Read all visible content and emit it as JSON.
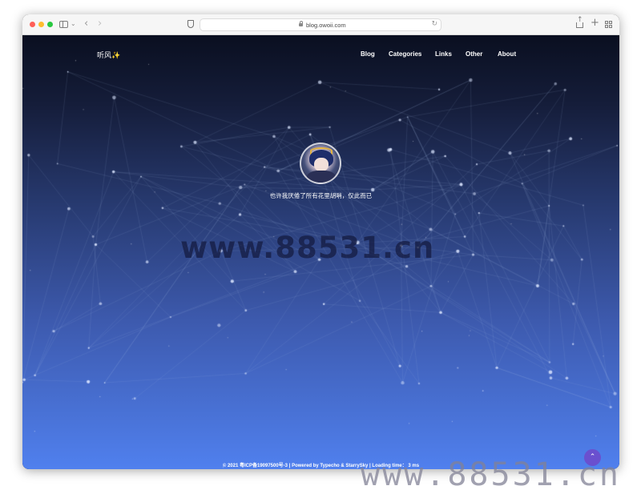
{
  "browser": {
    "url": "blog.owoii.com"
  },
  "site": {
    "brand": "听风✨",
    "nav": [
      {
        "label": "Blog"
      },
      {
        "label": "Categories"
      },
      {
        "label": "Links"
      },
      {
        "label": "Other"
      },
      {
        "label": "About"
      }
    ],
    "motto": "也许我厌倦了所有花里胡哨，仅此而已",
    "avatar_alt": "anime avatar"
  },
  "footer": {
    "copyright": "© 2021",
    "icp": "粤ICP备19097500号-3",
    "sep1": "|",
    "powered_label": "Powered by",
    "typecho": "Typecho",
    "amp": "&",
    "theme": "StarrySky",
    "sep2": "|",
    "loading_label": "Loading time：",
    "loading_value": "3 ms"
  },
  "watermark": {
    "center": "www.88531.cn",
    "corner": "www.88531.cn"
  },
  "colors": {
    "bg_top": "#0a0f20",
    "bg_bottom": "#5080ee",
    "to_top_button": "#6a50cf"
  }
}
